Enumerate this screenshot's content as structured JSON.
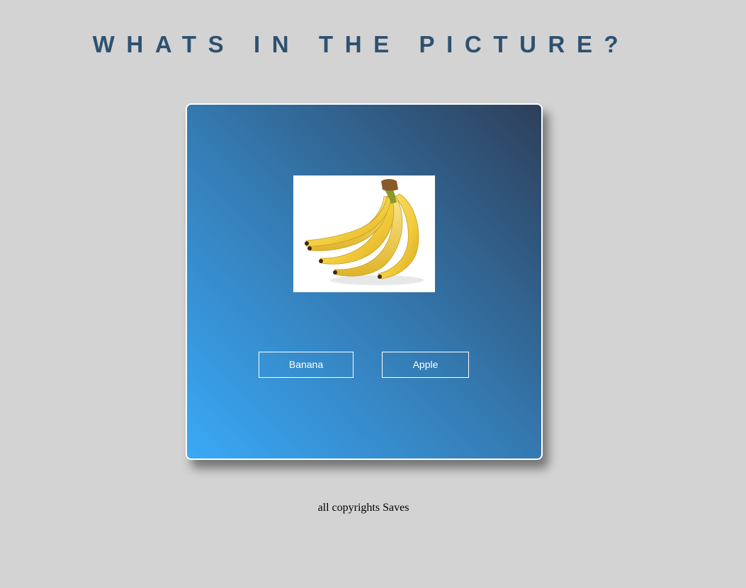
{
  "page": {
    "title": "WHATS IN THE PICTURE?"
  },
  "quiz": {
    "image_subject": "bananas",
    "options": [
      {
        "label": "Banana"
      },
      {
        "label": "Apple"
      }
    ]
  },
  "footer": {
    "text": "all copyrights Saves"
  },
  "colors": {
    "background": "#d3d3d3",
    "title": "#2e5170",
    "card_gradient_start": "#3aa9f7",
    "card_gradient_mid": "#3479b0",
    "card_gradient_end": "#2e3f5a",
    "button_border": "#ffffff"
  }
}
